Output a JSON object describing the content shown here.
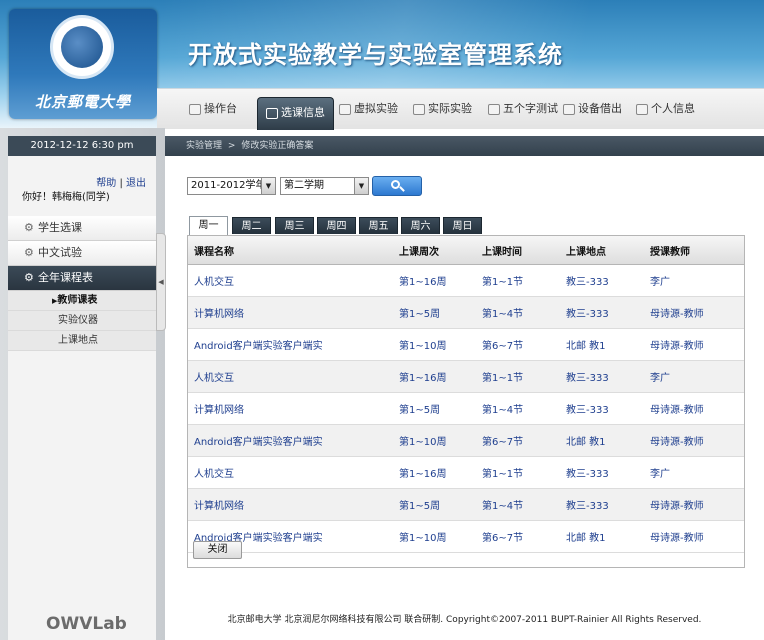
{
  "header": {
    "title": "开放式实验教学与实验室管理系统",
    "logo_text": "北京郵電大學"
  },
  "nav": [
    {
      "label": "操作台",
      "icon": "desktop-icon"
    },
    {
      "label": "选课信息",
      "icon": "grid-icon"
    },
    {
      "label": "虚拟实验",
      "icon": "cube-icon"
    },
    {
      "label": "实际实验",
      "icon": "tools-icon"
    },
    {
      "label": "五个字测试",
      "icon": "document-icon"
    },
    {
      "label": "设备借出",
      "icon": "calendar-icon"
    },
    {
      "label": "个人信息",
      "icon": "user-icon"
    }
  ],
  "sidebar": {
    "datetime": "2012-12-12 6:30 pm",
    "help": "帮助",
    "logout": "退出",
    "greeting": "你好！韩梅梅(同学)",
    "menu": [
      {
        "label": "学生选课"
      },
      {
        "label": "中文试验"
      },
      {
        "label": "全年课程表"
      }
    ],
    "submenu": [
      {
        "label": "教师课表"
      },
      {
        "label": "实验仪器"
      },
      {
        "label": "上课地点"
      }
    ],
    "brand": "OWVLab"
  },
  "breadcrumb": {
    "root": "实验管理",
    "separator": ">",
    "current": "修改实验正确答案"
  },
  "filters": {
    "year": "2011-2012学年",
    "term": "第二学期"
  },
  "tabs": [
    "周一",
    "周二",
    "周三",
    "周四",
    "周五",
    "周六",
    "周日"
  ],
  "table": {
    "headers": [
      "课程名称",
      "上课周次",
      "上课时间",
      "上课地点",
      "授课教师"
    ],
    "rows": [
      [
        "人机交互",
        "第1~16周",
        "第1~1节",
        "教三-333",
        "李广"
      ],
      [
        "计算机网络",
        "第1~5周",
        "第1~4节",
        "教三-333",
        "母诗源-教师"
      ],
      [
        "Android客户端实验客户端实",
        "第1~10周",
        "第6~7节",
        "北邮 教1",
        "母诗源-教师"
      ],
      [
        "人机交互",
        "第1~16周",
        "第1~1节",
        "教三-333",
        "李广"
      ],
      [
        "计算机网络",
        "第1~5周",
        "第1~4节",
        "教三-333",
        "母诗源-教师"
      ],
      [
        "Android客户端实验客户端实",
        "第1~10周",
        "第6~7节",
        "北邮 教1",
        "母诗源-教师"
      ],
      [
        "人机交互",
        "第1~16周",
        "第1~1节",
        "教三-333",
        "李广"
      ],
      [
        "计算机网络",
        "第1~5周",
        "第1~4节",
        "教三-333",
        "母诗源-教师"
      ],
      [
        "Android客户端实验客户端实",
        "第1~10周",
        "第6~7节",
        "北邮 教1",
        "母诗源-教师"
      ]
    ]
  },
  "close_label": "关闭",
  "footer": "北京邮电大学 北京润尼尔网络科技有限公司 联合研制. Copyright©2007-2011 BUPT-Rainier All Rights Reserved."
}
